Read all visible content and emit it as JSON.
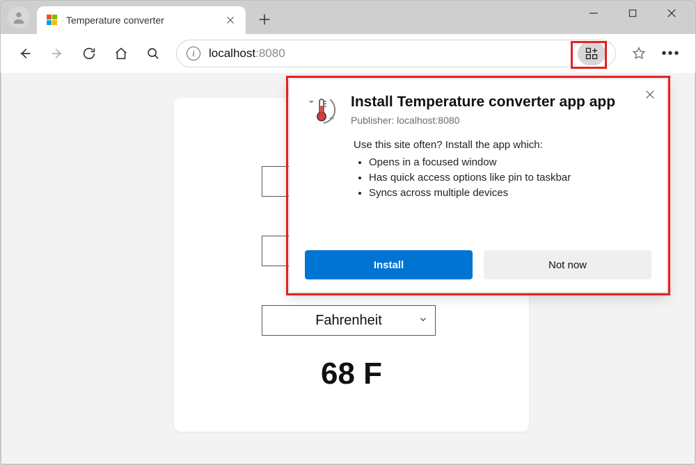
{
  "tab": {
    "title": "Temperature converter"
  },
  "address": {
    "host": "localhost",
    "port": ":8080"
  },
  "page": {
    "select_value": "Fahrenheit",
    "result": "68 F"
  },
  "prompt": {
    "title": "Install Temperature converter app app",
    "publisher": "Publisher: localhost:8080",
    "lead": "Use this site often? Install the app which:",
    "bullets": [
      "Opens in a focused window",
      "Has quick access options like pin to taskbar",
      "Syncs across multiple devices"
    ],
    "install": "Install",
    "not_now": "Not now"
  }
}
